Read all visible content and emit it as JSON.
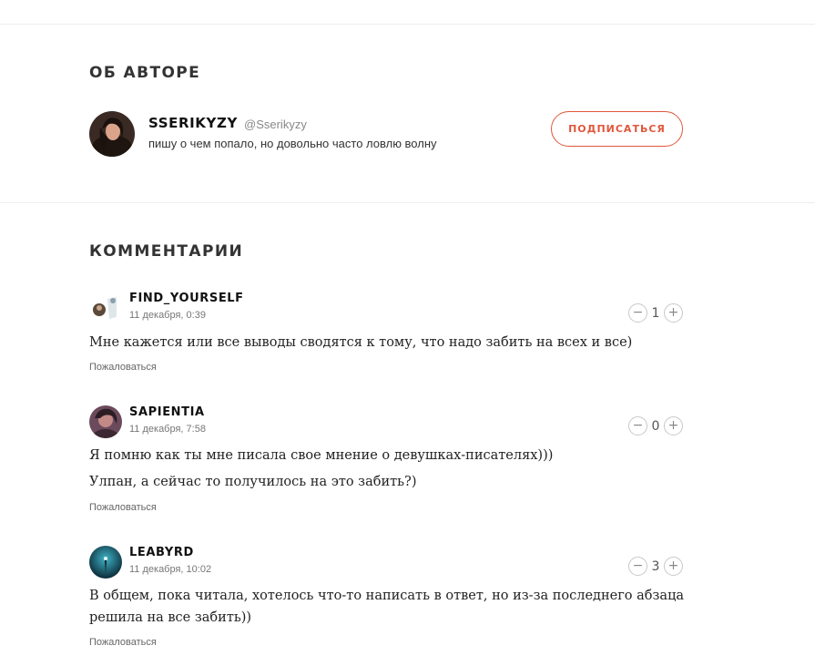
{
  "author_section": {
    "title": "ОБ АВТОРЕ",
    "name": "SSERIKYZY",
    "handle": "@Sserikyzy",
    "bio": "пишу о чем попало, но довольно часто ловлю волну",
    "subscribe_label": "ПОДПИСАТЬСЯ"
  },
  "comments_section": {
    "title": "КОММЕНТАРИИ",
    "report_label": "Пожаловаться",
    "comments": [
      {
        "name": "FIND_YOURSELF",
        "date": "11 декабря, 0:39",
        "votes": "1",
        "lines": [
          "Мне кажется или все  выводы сводятся к тому,  что надо забить на всех и все)"
        ]
      },
      {
        "name": "SAPIENTIA",
        "date": "11 декабря, 7:58",
        "votes": "0",
        "lines": [
          "Я помню как ты мне писала свое мнение о девушках-писателях)))",
          "Улпан, а сейчас то получилось на это забить?)"
        ]
      },
      {
        "name": "LEABYRD",
        "date": "11 декабря, 10:02",
        "votes": "3",
        "lines": [
          "В общем, пока читала, хотелось что-то написать в ответ, но из-за последнего абзаца",
          "решила на все забить))"
        ]
      }
    ]
  },
  "colors": {
    "accent": "#e0573a"
  }
}
